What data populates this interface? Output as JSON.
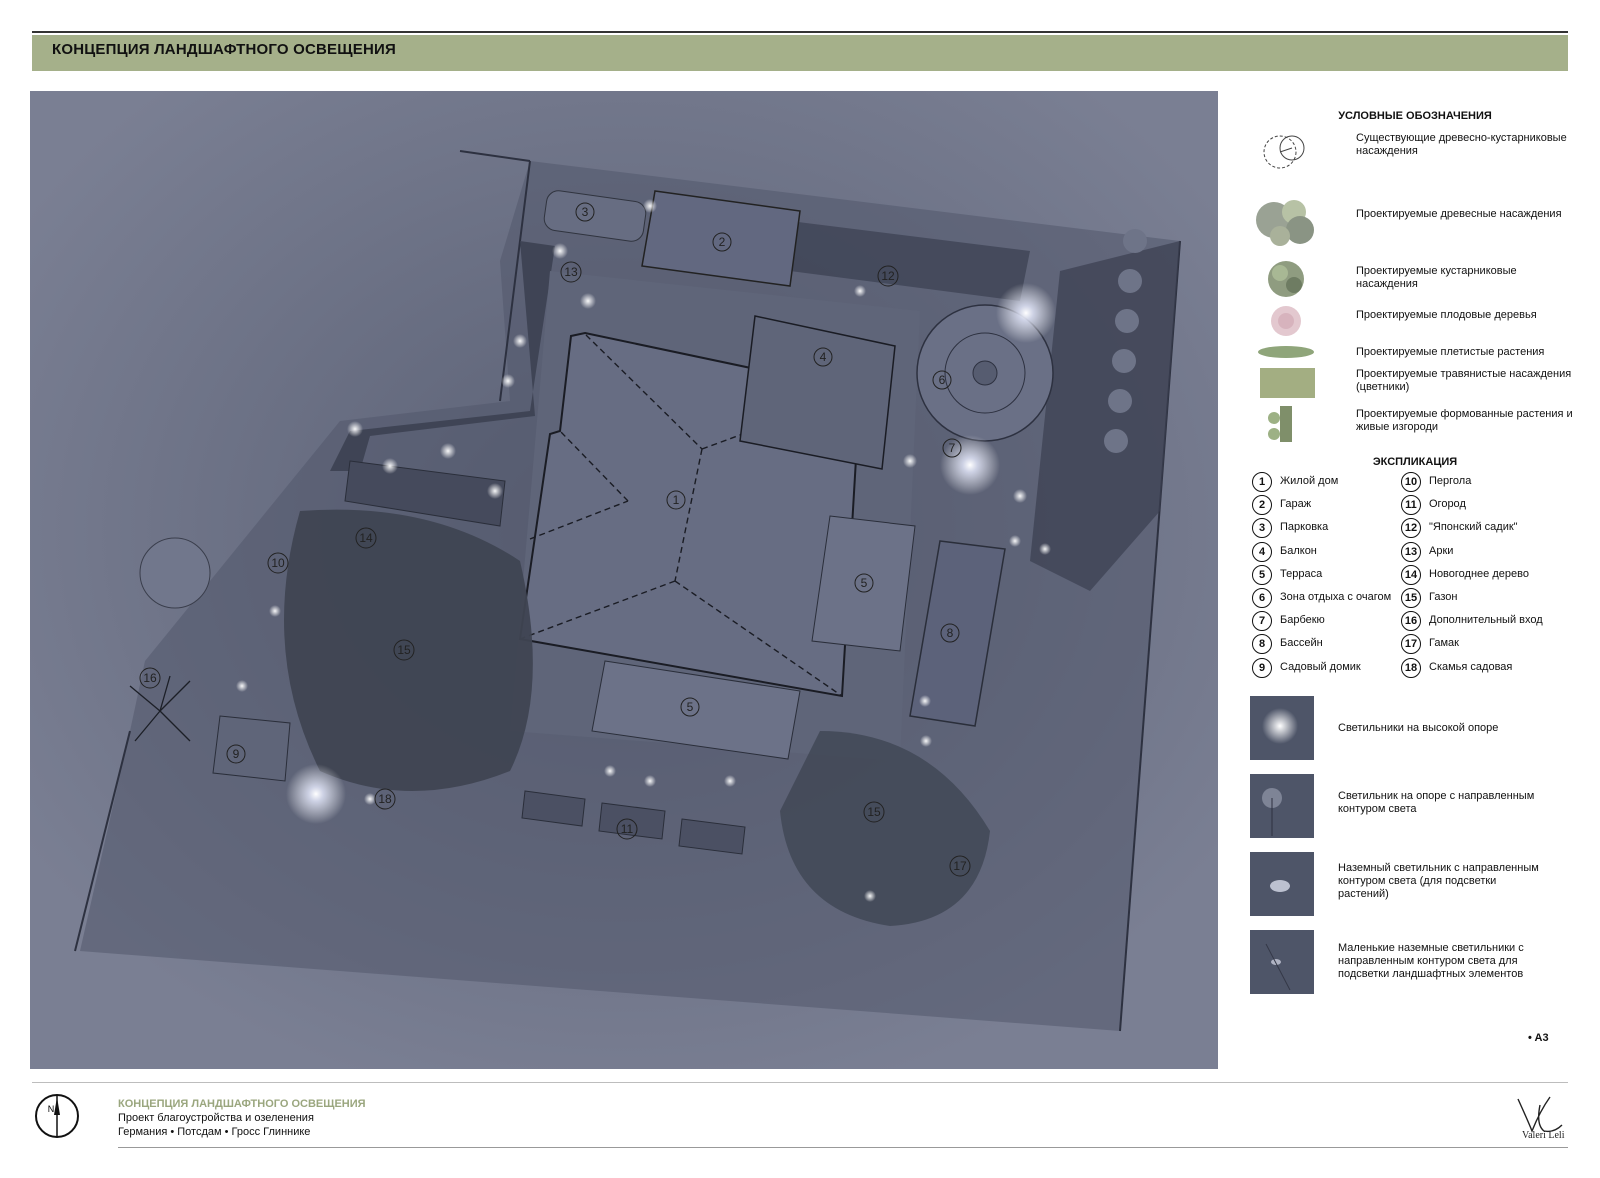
{
  "header": {
    "title": "КОНЦЕПЦИЯ ЛАНДШАФТНОГО ОСВЕЩЕНИЯ"
  },
  "plan": {
    "labels": [
      "1",
      "2",
      "3",
      "4",
      "5",
      "5",
      "6",
      "7",
      "8",
      "9",
      "10",
      "11",
      "12",
      "13",
      "14",
      "15",
      "15",
      "16",
      "17",
      "18"
    ]
  },
  "legend": {
    "title": "УСЛОВНЫЕ ОБОЗНАЧЕНИЯ",
    "items": [
      {
        "icon": "existing-trees-icon",
        "text": "Существующие древесно-кустарниковые насаждения"
      },
      {
        "icon": "designed-trees-icon",
        "text": "Проектируемые  древесные насаждения"
      },
      {
        "icon": "designed-shrubs-icon",
        "text": "Проектируемые кустарниковые насаждения"
      },
      {
        "icon": "fruit-trees-icon",
        "text": "Проектируемые плодовые деревья"
      },
      {
        "icon": "climbing-plants-icon",
        "text": "Проектируемые плетистые растения"
      },
      {
        "icon": "herbaceous-plants-icon",
        "text": "Проектируемые травянистые насаждения (цветники)"
      },
      {
        "icon": "topiary-hedges-icon",
        "text": "Проектируемые формованные растения и живые изгороди"
      }
    ]
  },
  "explication": {
    "title": "ЭКСПЛИКАЦИЯ",
    "items": [
      {
        "num": "1",
        "label": "Жилой дом"
      },
      {
        "num": "2",
        "label": "Гараж"
      },
      {
        "num": "3",
        "label": "Парковка"
      },
      {
        "num": "4",
        "label": "Балкон"
      },
      {
        "num": "5",
        "label": "Терраса"
      },
      {
        "num": "6",
        "label": "Зона отдыха с очагом"
      },
      {
        "num": "7",
        "label": "Барбекю"
      },
      {
        "num": "8",
        "label": "Бассейн"
      },
      {
        "num": "9",
        "label": "Садовый домик"
      },
      {
        "num": "10",
        "label": "Пергола"
      },
      {
        "num": "11",
        "label": "Огород"
      },
      {
        "num": "12",
        "label": "\"Японский садик\""
      },
      {
        "num": "13",
        "label": "Арки"
      },
      {
        "num": "14",
        "label": "Новогоднее дерево"
      },
      {
        "num": "15",
        "label": "Газон"
      },
      {
        "num": "16",
        "label": "Дополнительный вход"
      },
      {
        "num": "17",
        "label": "Гамак"
      },
      {
        "num": "18",
        "label": "Скамья садовая"
      }
    ]
  },
  "lights": [
    {
      "icon": "high-pole-light-icon",
      "text": "Светильники на высокой опоре"
    },
    {
      "icon": "pole-directed-light-icon",
      "text": "Светильник на опоре с направленным контуром света"
    },
    {
      "icon": "ground-light-icon",
      "text": "Наземный светильник с направленным контуром света (для подсветки растений)"
    },
    {
      "icon": "small-ground-lights-icon",
      "text": "Маленькие наземные светильники с направленным контуром света  для подсветки ландшафтных элементов"
    }
  ],
  "sheet_format": "• A3",
  "footer": {
    "title": "КОНЦЕПЦИЯ ЛАНДШАФТНОГО ОСВЕЩЕНИЯ",
    "subtitle": "Проект благоустройства и озеленения",
    "location": "Германия  •  Потсдам  •  Гросс Глиннике",
    "compass_letter": "N",
    "signature": "Valeri Leli"
  },
  "colors": {
    "title_bar": "#a5b08a",
    "plan_background": "#6b7086",
    "lawn": "#3f4552",
    "roof": "#676d83",
    "footer_accent": "#9aa67e"
  }
}
